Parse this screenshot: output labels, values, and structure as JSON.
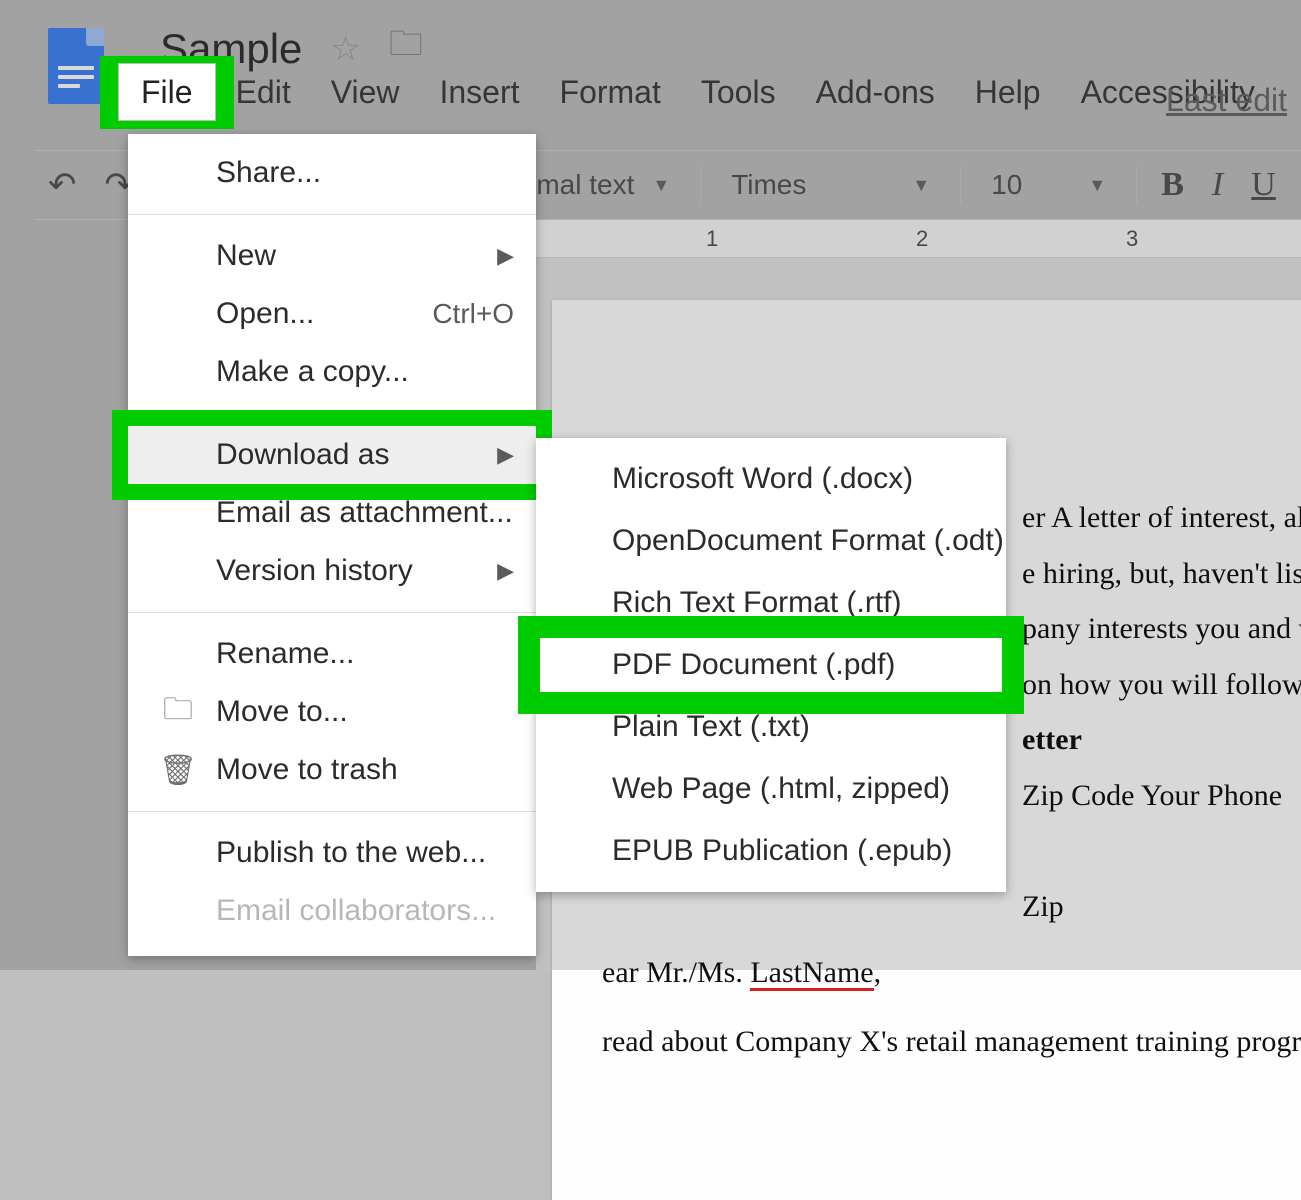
{
  "doc": {
    "title": "Sample",
    "last_edit": "Last edit"
  },
  "menubar": {
    "file": "File",
    "edit": "Edit",
    "view": "View",
    "insert": "Insert",
    "format": "Format",
    "tools": "Tools",
    "addons": "Add-ons",
    "help": "Help",
    "accessibility": "Accessibility"
  },
  "toolbar": {
    "style_partial": "rmal text",
    "font": "Times",
    "size": "10",
    "bold": "B",
    "italic": "I",
    "underline": "U"
  },
  "ruler": {
    "n1": "1",
    "n2": "2",
    "n3": "3"
  },
  "file_menu": {
    "share": "Share...",
    "new": "New",
    "open": "Open...",
    "open_kbd": "Ctrl+O",
    "make_copy": "Make a copy...",
    "download_as": "Download as",
    "email_attachment": "Email as attachment...",
    "version_history": "Version history",
    "rename": "Rename...",
    "move_to": "Move to...",
    "move_to_trash": "Move to trash",
    "publish": "Publish to the web...",
    "email_collab": "Email collaborators..."
  },
  "download_submenu": {
    "docx": "Microsoft Word (.docx)",
    "odt": "OpenDocument Format (.odt)",
    "rtf": "Rich Text Format (.rtf)",
    "pdf": "PDF Document (.pdf)",
    "txt": "Plain Text (.txt)",
    "html": "Web Page (.html, zipped)",
    "epub": "EPUB Publication (.epub)"
  },
  "page_text": {
    "l1": "er A letter of interest, al",
    "l2": "e hiring, but, haven't list",
    "l3": "pany interests you and w",
    "l4": "on how you will follow-",
    "l5": "etter",
    "l6": "Zip Code Your Phone",
    "l7": "Zip",
    "l8a": "ear Mr./Ms. ",
    "l8b": "LastName",
    "l8c": ",",
    "l9": "read about Company X's retail management training program in C"
  }
}
